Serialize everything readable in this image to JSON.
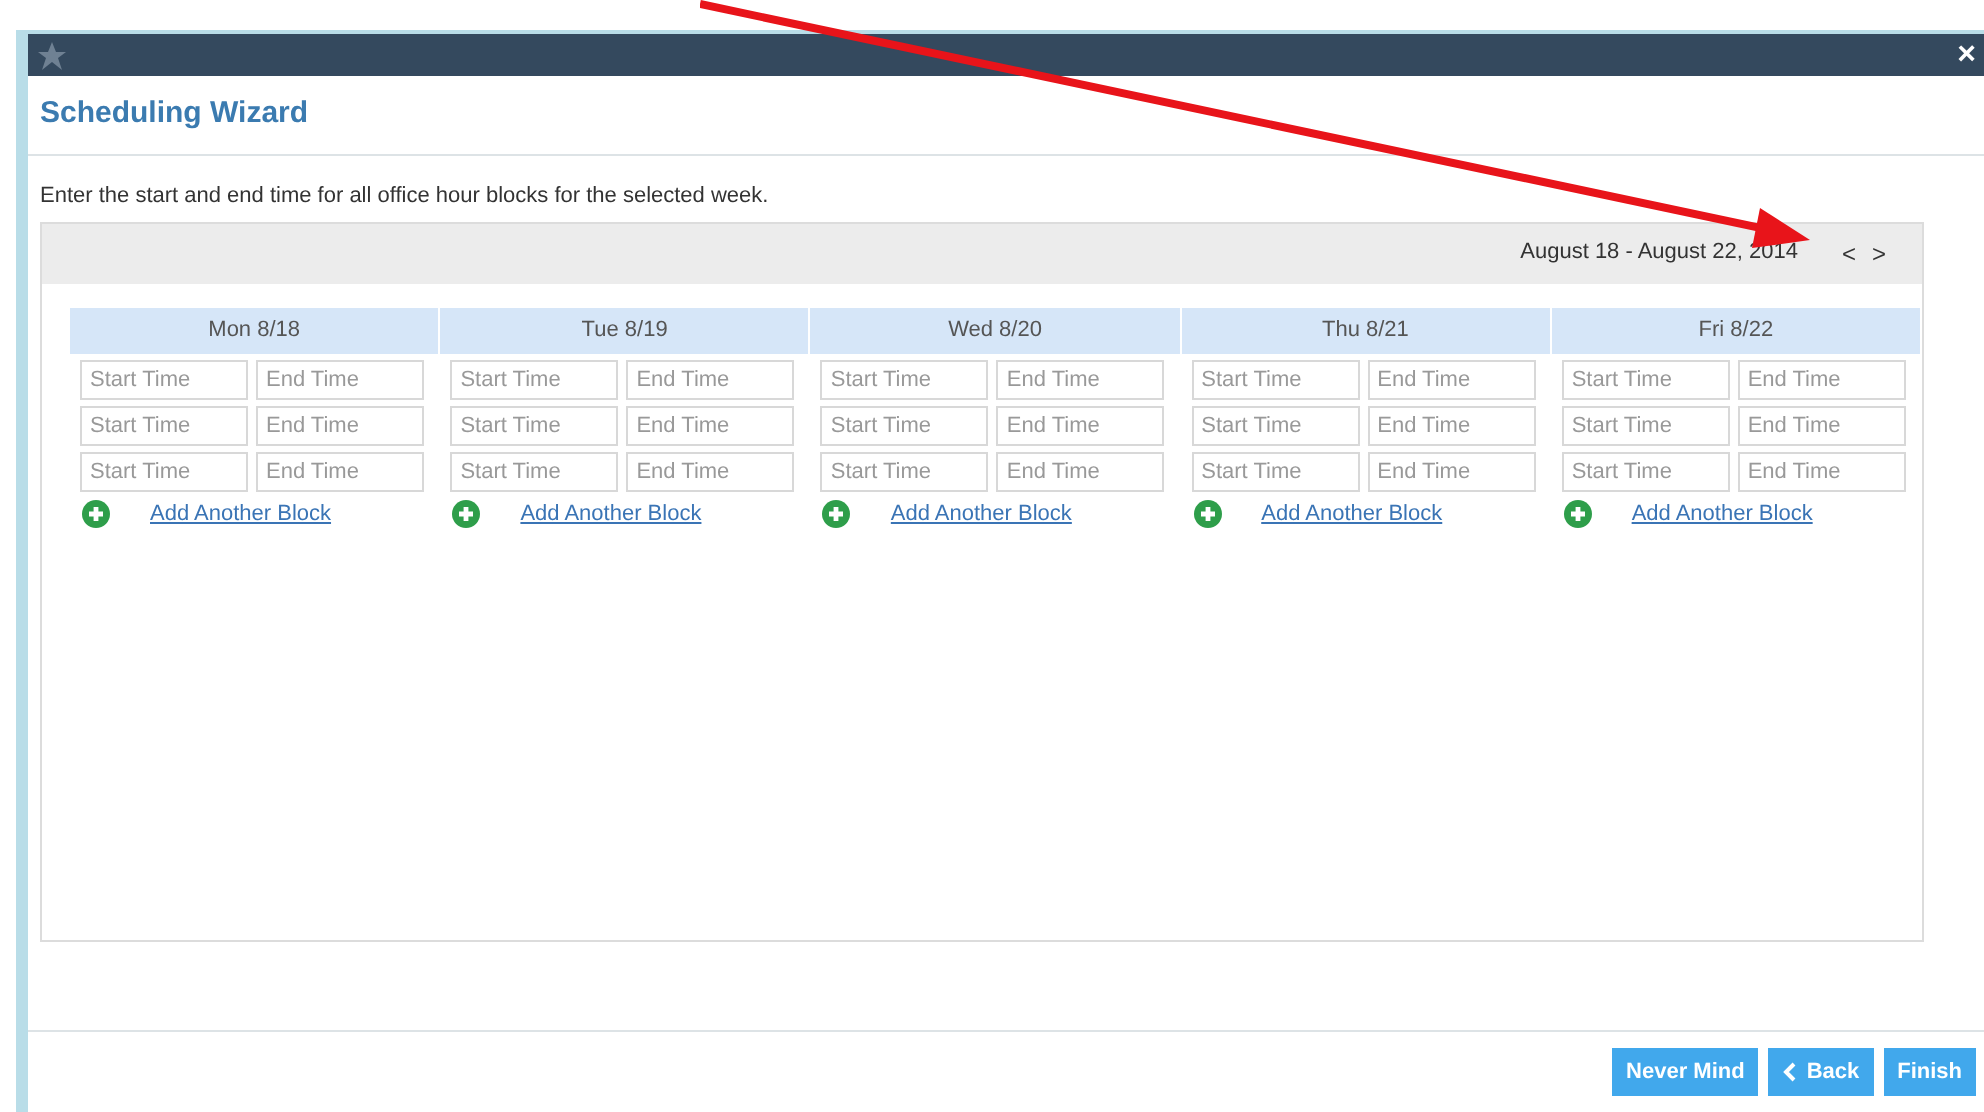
{
  "window": {
    "close": "×"
  },
  "title": "Scheduling Wizard",
  "instructions": "Enter the start and end time for all office hour blocks for the selected week.",
  "week": {
    "range": "August 18 - August 22, 2014",
    "prev": "<",
    "next": ">"
  },
  "days": [
    {
      "label": "Mon 8/18",
      "blocks": [
        {
          "start": {
            "placeholder": "Start Time"
          },
          "end": {
            "placeholder": "End Time"
          }
        },
        {
          "start": {
            "placeholder": "Start Time"
          },
          "end": {
            "placeholder": "End Time"
          }
        },
        {
          "start": {
            "placeholder": "Start Time"
          },
          "end": {
            "placeholder": "End Time"
          }
        }
      ],
      "add": "Add Another Block"
    },
    {
      "label": "Tue 8/19",
      "blocks": [
        {
          "start": {
            "placeholder": "Start Time"
          },
          "end": {
            "placeholder": "End Time"
          }
        },
        {
          "start": {
            "placeholder": "Start Time"
          },
          "end": {
            "placeholder": "End Time"
          }
        },
        {
          "start": {
            "placeholder": "Start Time"
          },
          "end": {
            "placeholder": "End Time"
          }
        }
      ],
      "add": "Add Another Block"
    },
    {
      "label": "Wed 8/20",
      "blocks": [
        {
          "start": {
            "placeholder": "Start Time"
          },
          "end": {
            "placeholder": "End Time"
          }
        },
        {
          "start": {
            "placeholder": "Start Time"
          },
          "end": {
            "placeholder": "End Time"
          }
        },
        {
          "start": {
            "placeholder": "Start Time"
          },
          "end": {
            "placeholder": "End Time"
          }
        }
      ],
      "add": "Add Another Block"
    },
    {
      "label": "Thu 8/21",
      "blocks": [
        {
          "start": {
            "placeholder": "Start Time"
          },
          "end": {
            "placeholder": "End Time"
          }
        },
        {
          "start": {
            "placeholder": "Start Time"
          },
          "end": {
            "placeholder": "End Time"
          }
        },
        {
          "start": {
            "placeholder": "Start Time"
          },
          "end": {
            "placeholder": "End Time"
          }
        }
      ],
      "add": "Add Another Block"
    },
    {
      "label": "Fri 8/22",
      "blocks": [
        {
          "start": {
            "placeholder": "Start Time"
          },
          "end": {
            "placeholder": "End Time"
          }
        },
        {
          "start": {
            "placeholder": "Start Time"
          },
          "end": {
            "placeholder": "End Time"
          }
        },
        {
          "start": {
            "placeholder": "Start Time"
          },
          "end": {
            "placeholder": "End Time"
          }
        }
      ],
      "add": "Add Another Block"
    }
  ],
  "buttons": [
    {
      "kind": "plain",
      "label": "Never Mind"
    },
    {
      "kind": "back",
      "label": "Back"
    },
    {
      "kind": "plain",
      "label": "Finish"
    }
  ]
}
